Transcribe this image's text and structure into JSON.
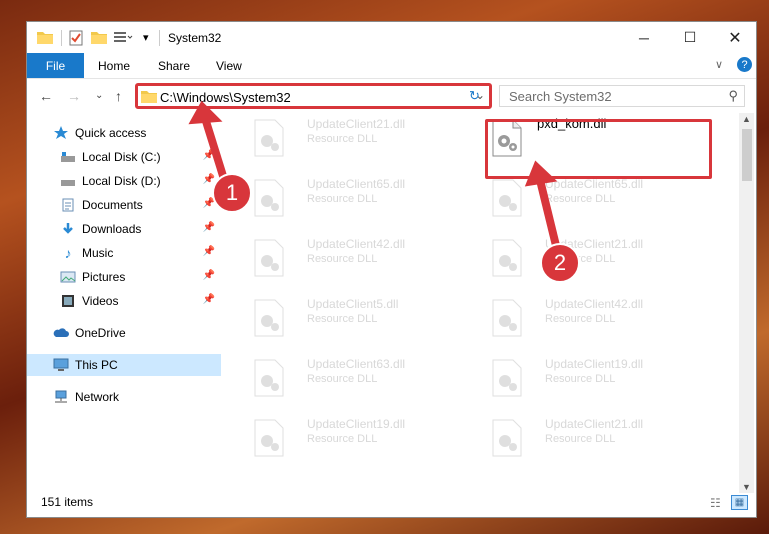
{
  "window": {
    "title": "System32"
  },
  "ribbon": {
    "file": "File",
    "home": "Home",
    "share": "Share",
    "view": "View"
  },
  "address": {
    "path": "C:\\Windows\\System32"
  },
  "search": {
    "placeholder": "Search System32"
  },
  "sidebar": {
    "quick_access": "Quick access",
    "local_c": "Local Disk (C:)",
    "local_d": "Local Disk (D:)",
    "documents": "Documents",
    "downloads": "Downloads",
    "music": "Music",
    "pictures": "Pictures",
    "videos": "Videos",
    "onedrive": "OneDrive",
    "this_pc": "This PC",
    "network": "Network"
  },
  "files": {
    "target": {
      "name": "pxd_kom.dll",
      "type": ""
    },
    "left": [
      {
        "name": "UpdateClient21.dll",
        "type": "Resource DLL"
      },
      {
        "name": "UpdateClient65.dll",
        "type": "Resource DLL"
      },
      {
        "name": "UpdateClient42.dll",
        "type": "Resource DLL"
      },
      {
        "name": "UpdateClient5.dll",
        "type": "Resource DLL"
      },
      {
        "name": "UpdateClient63.dll",
        "type": "Resource DLL"
      },
      {
        "name": "UpdateClient19.dll",
        "type": "Resource DLL"
      }
    ],
    "right": [
      {
        "name": "UpdateClient65.dll",
        "type": "Resource DLL"
      },
      {
        "name": "UpdateClient21.dll",
        "type": "Resource DLL"
      },
      {
        "name": "UpdateClient42.dll",
        "type": "Resource DLL"
      },
      {
        "name": "UpdateClient19.dll",
        "type": "Resource DLL"
      },
      {
        "name": "UpdateClient21.dll",
        "type": "Resource DLL"
      }
    ]
  },
  "status": {
    "items": "151 items"
  },
  "annotations": {
    "step1": "1",
    "step2": "2"
  },
  "colors": {
    "accent": "#1979ca",
    "annotation": "#d8363b",
    "selected": "#cce8ff"
  }
}
